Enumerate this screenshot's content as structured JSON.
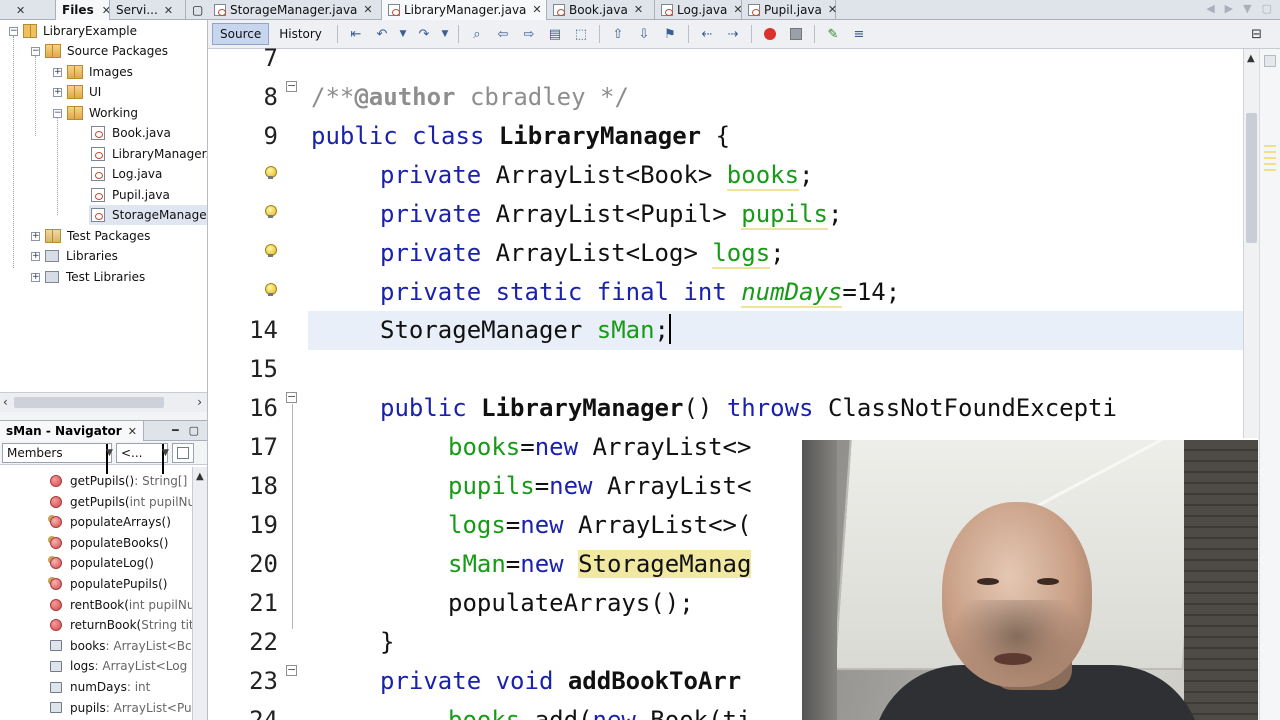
{
  "left_pane": {
    "tabs": [
      {
        "label": "Files"
      },
      {
        "label": "Servi..."
      }
    ],
    "tree": {
      "root": "LibraryExample",
      "source_packages": "Source Packages",
      "pkg_images": "Images",
      "pkg_ui": "UI",
      "pkg_working": "Working",
      "files": [
        "Book.java",
        "LibraryManager.",
        "Log.java",
        "Pupil.java",
        "StorageManager"
      ],
      "test_packages": "Test Packages",
      "libraries": "Libraries",
      "test_libraries": "Test Libraries"
    }
  },
  "navigator": {
    "title": "sMan - Navigator",
    "filter_label": "Members",
    "filter_extra": "<...",
    "members": [
      {
        "name": "getPupils()",
        "sig": " : String[]",
        "kind": "method"
      },
      {
        "name": "getPupils(",
        "sig": "int pupilNur",
        "kind": "method"
      },
      {
        "name": "populateArrays()",
        "sig": "",
        "kind": "method-gear"
      },
      {
        "name": "populateBooks()",
        "sig": "",
        "kind": "method-gear"
      },
      {
        "name": "populateLog()",
        "sig": "",
        "kind": "method-gear"
      },
      {
        "name": "populatePupils()",
        "sig": "",
        "kind": "method-gear"
      },
      {
        "name": "rentBook(",
        "sig": "int pupilNur",
        "kind": "method"
      },
      {
        "name": "returnBook(",
        "sig": "String titl",
        "kind": "method"
      },
      {
        "name": "books",
        "sig": " : ArrayList<Bc",
        "kind": "field"
      },
      {
        "name": "logs",
        "sig": " : ArrayList<Log",
        "kind": "field"
      },
      {
        "name": "numDays",
        "sig": " : int",
        "kind": "field"
      },
      {
        "name": "pupils",
        "sig": " : ArrayList<Pu",
        "kind": "field"
      }
    ]
  },
  "editor": {
    "tabs": [
      {
        "label": "StorageManager.java",
        "active": false
      },
      {
        "label": "LibraryManager.java",
        "active": true
      },
      {
        "label": "Book.java",
        "active": false
      },
      {
        "label": "Log.java",
        "active": false
      },
      {
        "label": "Pupil.java",
        "active": false
      }
    ],
    "toolbar": {
      "source_label": "Source",
      "history_label": "History"
    },
    "line_numbers": [
      "7",
      "8",
      "9",
      "",
      "",
      "",
      "",
      "14",
      "15",
      "16",
      "17",
      "18",
      "19",
      "20",
      "21",
      "22",
      "23",
      "24"
    ],
    "code": {
      "l7": "",
      "l8_a": "/**",
      "l8_b": "@author",
      "l8_c": " cbradley */",
      "l9_a": "public class ",
      "l9_b": "LibraryManager",
      "l9_c": " {",
      "l10_a": "private",
      "l10_b": " ArrayList<Book> ",
      "l10_c": "books",
      "l10_d": ";",
      "l11_a": "private",
      "l11_b": " ArrayList<Pupil> ",
      "l11_c": "pupils",
      "l11_d": ";",
      "l12_a": "private",
      "l12_b": " ArrayList<Log> ",
      "l12_c": "logs",
      "l12_d": ";",
      "l13_a": "private static final int ",
      "l13_b": "numDays",
      "l13_c": "=14;",
      "l14_a": "StorageManager ",
      "l14_b": "sMan",
      "l14_c": ";",
      "l16_a": "public ",
      "l16_b": "LibraryManager",
      "l16_c": "() ",
      "l16_d": "throws",
      "l16_e": " ClassNotFoundExcepti",
      "l17_a": "books",
      "l17_b": "=",
      "l17_c": "new",
      "l17_d": " ArrayList<>",
      "l18_a": "pupils",
      "l18_b": "=",
      "l18_c": "new",
      "l18_d": " ArrayList<",
      "l19_a": "logs",
      "l19_b": "=",
      "l19_c": "new",
      "l19_d": " ArrayList<>(",
      "l20_a": "sMan",
      "l20_b": "=",
      "l20_c": "new",
      "l20_d": " ",
      "l20_e": "StorageManag",
      "l21": "populateArrays();",
      "l22": "}",
      "l23_a": "private void ",
      "l23_b": "addBookToArr",
      "l24_a": "books",
      "l24_b": ".add(",
      "l24_c": "new",
      "l24_d": " Book(ti"
    }
  },
  "colors": {
    "keyword": "#1a22ad",
    "field": "#179b17",
    "comment": "#8e8e8e",
    "current_line": "#e9eff8",
    "usage_highlight": "#f1e8a2"
  }
}
